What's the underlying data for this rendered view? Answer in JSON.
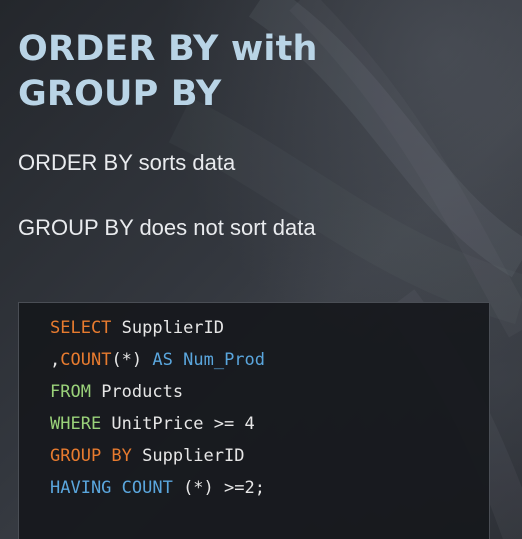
{
  "title": {
    "line1": "ORDER BY with",
    "line2": "GROUP BY"
  },
  "bullets": [
    "ORDER BY sorts data",
    "GROUP BY does not sort data"
  ],
  "code": {
    "line1": {
      "kw": "SELECT",
      "rest": " SupplierID"
    },
    "line2": {
      "lead": ",",
      "fn": "COUNT",
      "mid": "(*) ",
      "kw": "AS",
      "sp": " ",
      "alias": "Num_Prod"
    },
    "line3": {
      "kw": "FROM",
      "rest": " Products"
    },
    "line4": {
      "kw": "WHERE",
      "rest": " UnitPrice >= 4"
    },
    "line5": {
      "kw": "GROUP BY",
      "rest": " SupplierID"
    },
    "line6": {
      "kw": "HAVING COUNT",
      "rest": " (*) >=2;"
    }
  },
  "colors": {
    "title": "#b9d4e6",
    "keyword_orange": "#e77b2f",
    "keyword_green": "#9ad27a",
    "keyword_blue": "#5aa6dd",
    "code_text": "#e6e6e6",
    "code_background": "#16181c"
  }
}
